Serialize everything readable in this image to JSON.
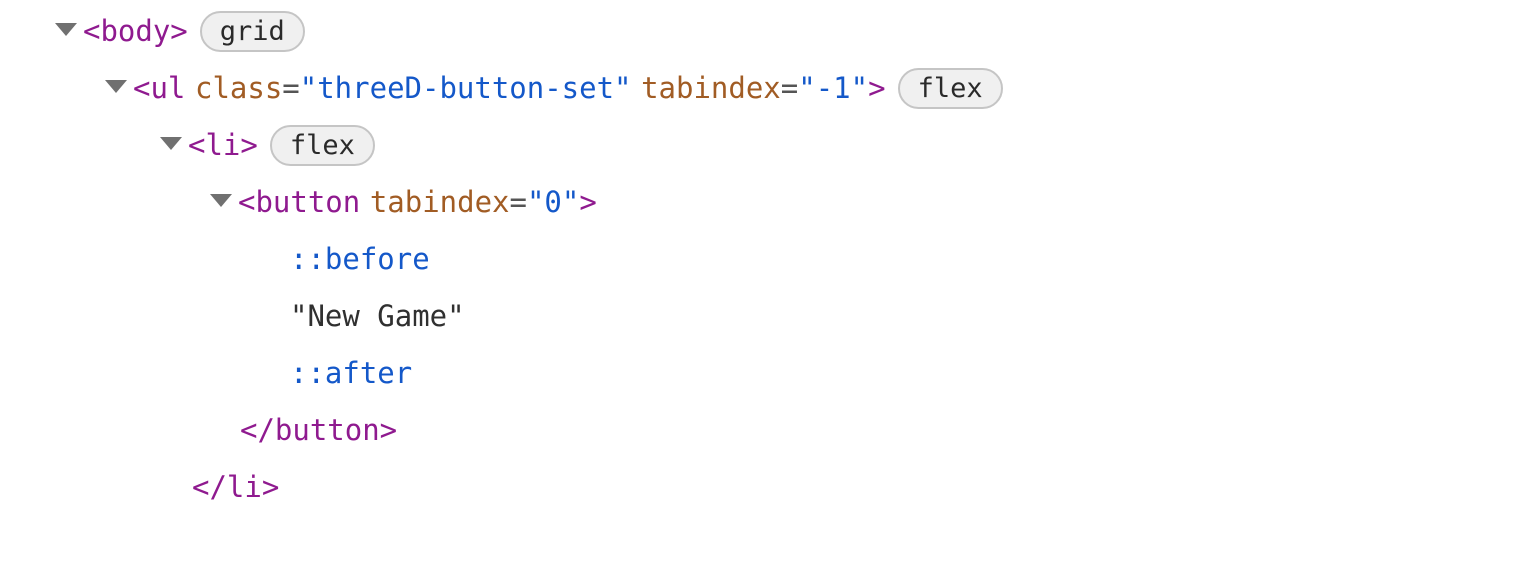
{
  "rows": {
    "r0": {
      "tag_open": "<body>",
      "badge": "grid"
    },
    "r1": {
      "tag_open_start": "<ul",
      "attr1_name": "class",
      "attr1_eq": "=",
      "attr1_val": "\"threeD-button-set\"",
      "attr2_name": "tabindex",
      "attr2_eq": "=",
      "attr2_val": "\"-1\"",
      "tag_open_end": ">",
      "badge": "flex"
    },
    "r2": {
      "tag_open": "<li>",
      "badge": "flex"
    },
    "r3": {
      "tag_open_start": "<button",
      "attr1_name": "tabindex",
      "attr1_eq": "=",
      "attr1_val": "\"0\"",
      "tag_open_end": ">"
    },
    "r4": {
      "pseudo": "::before"
    },
    "r5": {
      "text": "\"New Game\""
    },
    "r6": {
      "pseudo": "::after"
    },
    "r7": {
      "tag_close": "</button>"
    },
    "r8": {
      "tag_close": "</li>"
    }
  }
}
